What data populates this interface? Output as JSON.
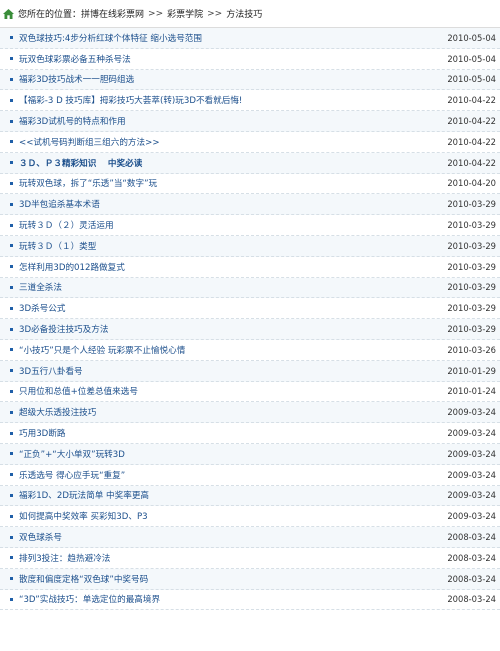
{
  "breadcrumb": {
    "label": "您所在的位置：",
    "items": [
      "拼博在线彩票网",
      "彩票学院",
      "方法技巧"
    ],
    "separator": ">>"
  },
  "colors": {
    "link": "#1c4f8c",
    "bullet": "#1f5fa8"
  },
  "articles": [
    {
      "title": "双色球技巧:4步分析红球个体特征 缩小选号范围",
      "date": "2010-05-04",
      "bold": false
    },
    {
      "title": "玩双色球彩票必备五种杀号法",
      "date": "2010-05-04",
      "bold": false
    },
    {
      "title": "福彩3D技巧战术一一胆码组选",
      "date": "2010-05-04",
      "bold": false
    },
    {
      "title": "【福彩-3 D 技巧库】拇彩技巧大荟萃(转)玩3D不看就后悔!",
      "date": "2010-04-22",
      "bold": false
    },
    {
      "title": "福彩3D试机号的特点和作用",
      "date": "2010-04-22",
      "bold": false
    },
    {
      "title": "<<试机号码判断组三组六的方法>>",
      "date": "2010-04-22",
      "bold": false
    },
    {
      "title": "３Ｄ、Ｐ３精彩知识　 中奖必读",
      "date": "2010-04-22",
      "bold": true
    },
    {
      "title": "玩转双色球，拆了“乐透”当“数字”玩",
      "date": "2010-04-20",
      "bold": false
    },
    {
      "title": "3D半包追杀基本术语",
      "date": "2010-03-29",
      "bold": false
    },
    {
      "title": "玩转３Ｄ（２）灵活运用",
      "date": "2010-03-29",
      "bold": false
    },
    {
      "title": "玩转３Ｄ（１）类型",
      "date": "2010-03-29",
      "bold": false
    },
    {
      "title": "怎样利用3D的012路做复式",
      "date": "2010-03-29",
      "bold": false
    },
    {
      "title": "三道全杀法",
      "date": "2010-03-29",
      "bold": false
    },
    {
      "title": "3D杀号公式",
      "date": "2010-03-29",
      "bold": false
    },
    {
      "title": "3D必备投注技巧及方法",
      "date": "2010-03-29",
      "bold": false
    },
    {
      "title": "“小技巧”只是个人经验 玩彩票不止愉悦心情",
      "date": "2010-03-26",
      "bold": false
    },
    {
      "title": "3D五行八卦看号",
      "date": "2010-01-29",
      "bold": false
    },
    {
      "title": "只用位和总值+位差总值来选号",
      "date": "2010-01-24",
      "bold": false
    },
    {
      "title": "超级大乐透投注技巧",
      "date": "2009-03-24",
      "bold": false
    },
    {
      "title": "巧用3D断路",
      "date": "2009-03-24",
      "bold": false
    },
    {
      "title": "“正负”+“大小单双”玩转3D",
      "date": "2009-03-24",
      "bold": false
    },
    {
      "title": "乐透选号 得心应手玩“重复”",
      "date": "2009-03-24",
      "bold": false
    },
    {
      "title": "福彩1D、2D玩法简单 中奖率更高",
      "date": "2009-03-24",
      "bold": false
    },
    {
      "title": "如何提高中奖效率 买彩知3D、P3",
      "date": "2009-03-24",
      "bold": false
    },
    {
      "title": "双色球杀号",
      "date": "2008-03-24",
      "bold": false
    },
    {
      "title": "排列3投注：趋热避冷法",
      "date": "2008-03-24",
      "bold": false
    },
    {
      "title": "散度和偏度定格“双色球”中奖号码",
      "date": "2008-03-24",
      "bold": false
    },
    {
      "title": "“3D”实战技巧：单选定位的最高境界",
      "date": "2008-03-24",
      "bold": false
    }
  ]
}
